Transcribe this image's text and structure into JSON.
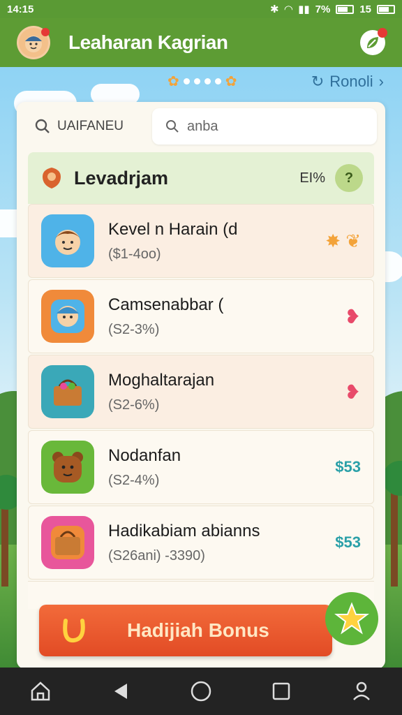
{
  "status_bar": {
    "time": "14:15",
    "battery_percent": "7%",
    "clock_right": "15"
  },
  "app_bar": {
    "title": "Leaharan Kagrian"
  },
  "top_strip": {
    "refresh_label": "Ronoli"
  },
  "search": {
    "filter_label": "UAIFANEU",
    "placeholder": "anba"
  },
  "level": {
    "title": "Levadrjam",
    "percent": "EI%",
    "badge": "?"
  },
  "items": [
    {
      "name": "Kevel n Harain (d",
      "price": "($1-4oo)",
      "trailing": "",
      "thumb_color": "#4fb3e8",
      "style": "warm"
    },
    {
      "name": "Camsenabbar (",
      "price": "(S2-3%)",
      "trailing": "",
      "thumb_color": "#f08a3a",
      "style": "light"
    },
    {
      "name": "Moghaltarajan",
      "price": "(S2-6%)",
      "trailing": "",
      "thumb_color": "#3aa8b8",
      "style": "warm"
    },
    {
      "name": "Nodanfan",
      "price": "(S2-4%)",
      "trailing": "$53",
      "thumb_color": "#69b83a",
      "style": "light"
    },
    {
      "name": "Hadikabiam abianns",
      "price": "(S26ani) -3390)",
      "trailing": "$53",
      "thumb_color": "#e8569b",
      "style": "light"
    }
  ],
  "bonus": {
    "label": "Hadijiah Bonus"
  },
  "colors": {
    "appbar": "#5d9c34",
    "accent_orange": "#e85a2c",
    "price_teal": "#2aa0a8"
  }
}
